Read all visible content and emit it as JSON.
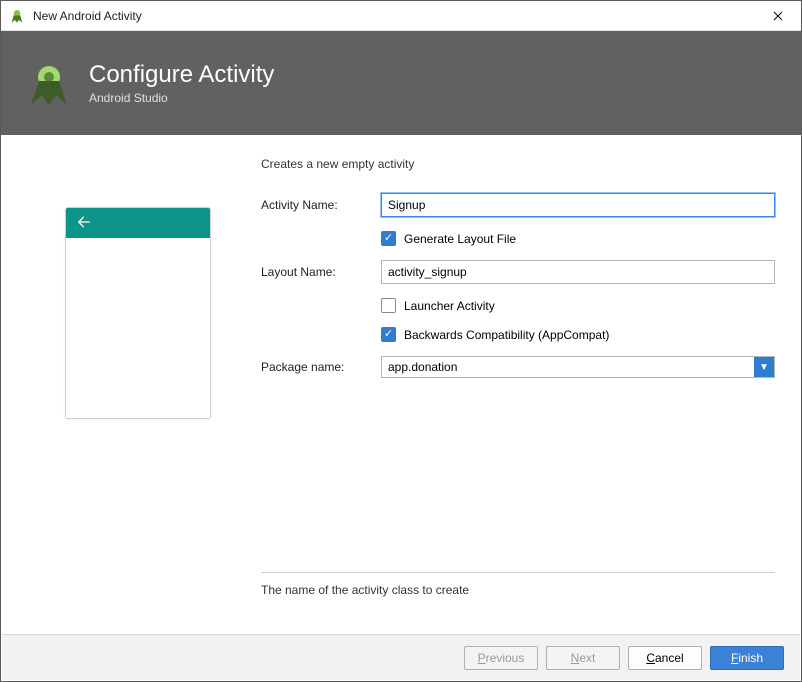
{
  "window": {
    "title": "New Android Activity"
  },
  "banner": {
    "title": "Configure Activity",
    "subtitle": "Android Studio"
  },
  "form": {
    "description": "Creates a new empty activity",
    "activity_name_label": "Activity Name:",
    "activity_name_value": "Signup",
    "generate_layout_label": "Generate Layout File",
    "generate_layout_checked": true,
    "layout_name_label": "Layout Name:",
    "layout_name_value": "activity_signup",
    "launcher_label": "Launcher Activity",
    "launcher_checked": false,
    "backwards_label": "Backwards Compatibility (AppCompat)",
    "backwards_checked": true,
    "package_label": "Package name:",
    "package_value": "app.donation",
    "help_text": "The name of the activity class to create"
  },
  "footer": {
    "previous": "Previous",
    "next": "Next",
    "cancel": "Cancel",
    "finish": "Finish"
  },
  "colors": {
    "accent": "#2f7dd1",
    "teal": "#0d9488",
    "banner": "#616161"
  },
  "icons": {
    "app": "android-studio-icon",
    "close": "close-icon",
    "back_arrow": "back-arrow-icon",
    "dropdown": "chevron-down-icon",
    "check": "check-icon"
  }
}
